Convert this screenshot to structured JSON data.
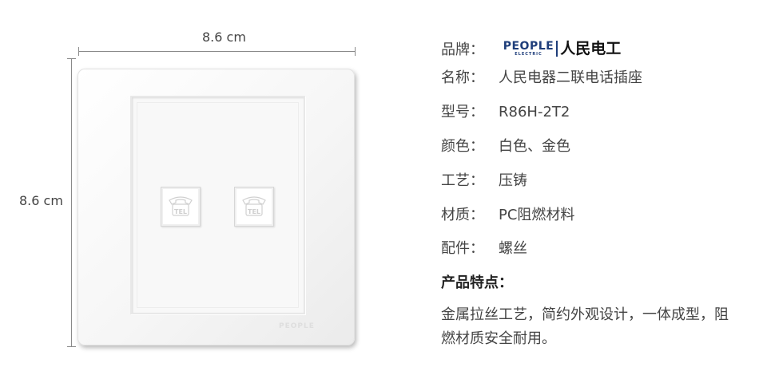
{
  "dimensions": {
    "width_label": "8.6 cm",
    "height_label": "8.6 cm"
  },
  "panel": {
    "watermark": "PEOPLE",
    "port_label": "TEL"
  },
  "brand": {
    "logo_en": "PEOPLE",
    "logo_en_sub": "ELECTRIC",
    "logo_cn": "人民电工",
    "brand_color": "#1e3d7a"
  },
  "specs": [
    {
      "key": "品牌：",
      "value": ""
    },
    {
      "key": "名称：",
      "value": "人民电器二联电话插座"
    },
    {
      "key": "型号：",
      "value": "R86H-2T2"
    },
    {
      "key": "颜色：",
      "value": "白色、金色"
    },
    {
      "key": "工艺：",
      "value": "压铸"
    },
    {
      "key": "材质：",
      "value": "PC阻燃材料"
    },
    {
      "key": "配件：",
      "value": "螺丝"
    }
  ],
  "features": {
    "title": "产品特点：",
    "text": "金属拉丝工艺，简约外观设计，一体成型，阻燃材质安全耐用。"
  }
}
